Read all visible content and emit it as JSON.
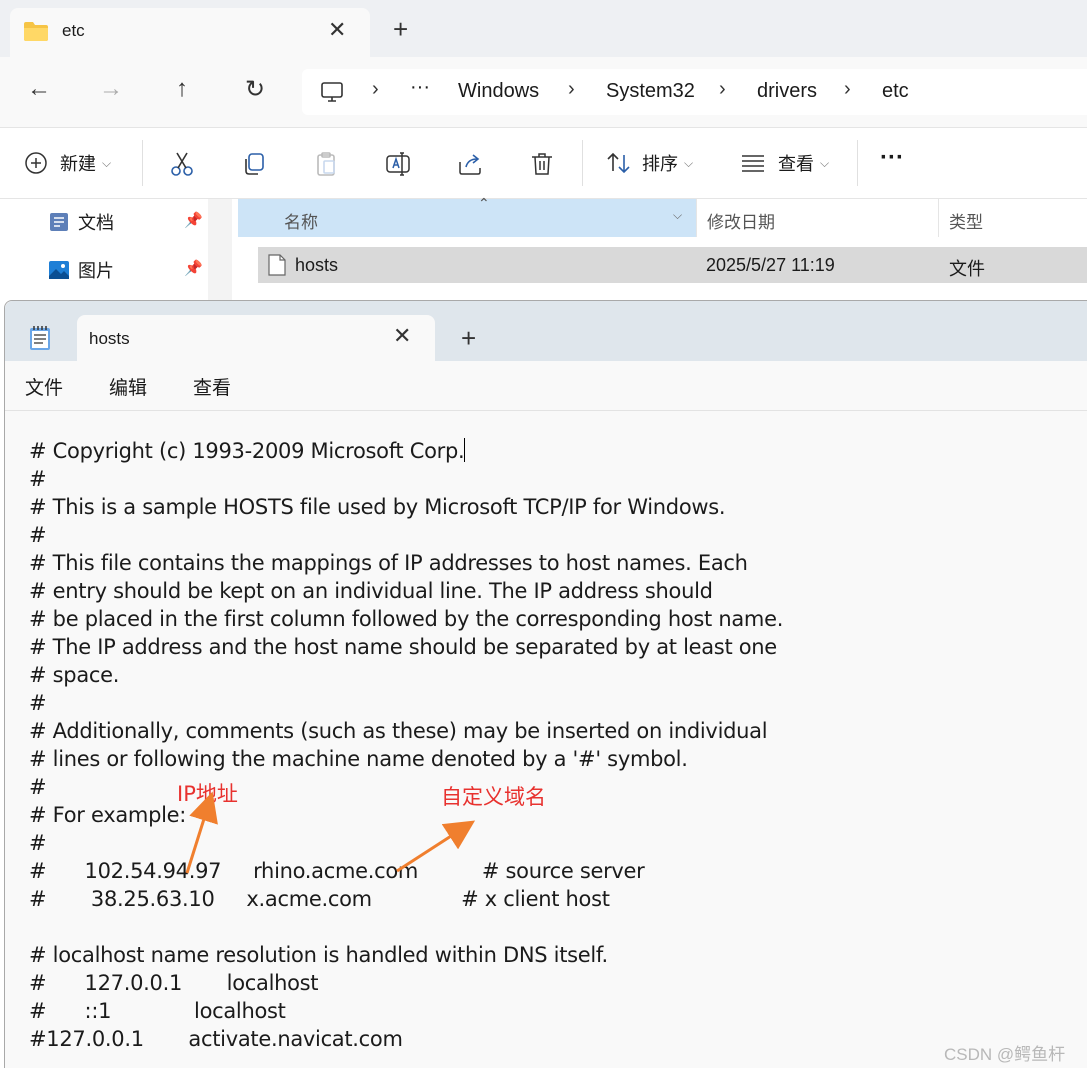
{
  "explorer": {
    "tab": {
      "title": "etc",
      "close": "✕",
      "new_tab": "+"
    },
    "nav": {
      "back": "←",
      "forward": "→",
      "up": "↑",
      "refresh": "↻"
    },
    "breadcrumb": {
      "overflow": "···",
      "items": [
        "Windows",
        "System32",
        "drivers",
        "etc"
      ],
      "separator": "›"
    },
    "toolbar": {
      "new_label": "新建",
      "sort_label": "排序",
      "view_label": "查看",
      "more_label": "···"
    },
    "sidebar": {
      "items": [
        {
          "label": "文档"
        },
        {
          "label": "图片"
        }
      ]
    },
    "columns": {
      "name": "名称",
      "date": "修改日期",
      "type": "类型"
    },
    "files": [
      {
        "name": "hosts",
        "date": "2025/5/27 11:19",
        "type": "文件"
      }
    ]
  },
  "notepad": {
    "tab": {
      "title": "hosts",
      "close": "✕",
      "new_tab": "+"
    },
    "menu": [
      "文件",
      "编辑",
      "查看"
    ],
    "lines": [
      "# Copyright (c) 1993-2009 Microsoft Corp.",
      "#",
      "# This is a sample HOSTS file used by Microsoft TCP/IP for Windows.",
      "#",
      "# This file contains the mappings of IP addresses to host names. Each",
      "# entry should be kept on an individual line. The IP address should",
      "# be placed in the first column followed by the corresponding host name.",
      "# The IP address and the host name should be separated by at least one",
      "# space.",
      "#",
      "# Additionally, comments (such as these) may be inserted on individual",
      "# lines or following the machine name denoted by a '#' symbol.",
      "#",
      "# For example:",
      "#",
      "#      102.54.94.97     rhino.acme.com          # source server",
      "#       38.25.63.10     x.acme.com              # x client host",
      "",
      "# localhost name resolution is handled within DNS itself.",
      "#      127.0.0.1       localhost",
      "#      ::1             localhost",
      "#127.0.0.1       activate.navicat.com"
    ],
    "annotations": {
      "ip": "IP地址",
      "domain": "自定义域名",
      "color": "#e8322f",
      "arrow_color": "#f07f2e"
    }
  },
  "watermark": "CSDN @鳄鱼杆"
}
